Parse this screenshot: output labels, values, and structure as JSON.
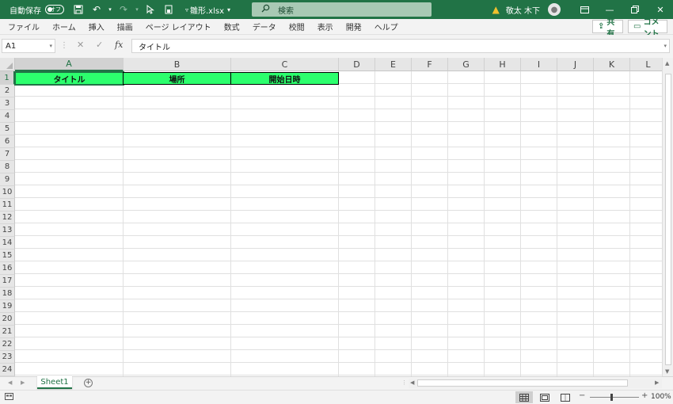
{
  "titlebar": {
    "autosave_label": "自動保存",
    "autosave_state": "オフ",
    "filename": "雛形.xlsx",
    "filename_dropdown": "▾",
    "search_placeholder": "検索",
    "username": "敬太 木下"
  },
  "ribbon": {
    "tabs": [
      "ファイル",
      "ホーム",
      "挿入",
      "描画",
      "ページ レイアウト",
      "数式",
      "データ",
      "校閲",
      "表示",
      "開発",
      "ヘルプ"
    ],
    "share_label": "共有",
    "comment_label": "コメント"
  },
  "formula_bar": {
    "name_box": "A1",
    "fx_label": "fx",
    "content": "タイトル"
  },
  "grid": {
    "columns": [
      "A",
      "B",
      "C",
      "D",
      "E",
      "F",
      "G",
      "H",
      "I",
      "J",
      "K",
      "L"
    ],
    "rows": [
      "1",
      "2",
      "3",
      "4",
      "5",
      "6",
      "7",
      "8",
      "9",
      "10",
      "11",
      "12",
      "13",
      "14",
      "15",
      "16",
      "17",
      "18",
      "19",
      "20",
      "21",
      "22",
      "23",
      "24"
    ],
    "header_cells": [
      "タイトル",
      "場所",
      "開始日時"
    ],
    "header_fill": "#2cff6d",
    "accent": "#217346"
  },
  "sheets": {
    "tabs": [
      "Sheet1"
    ],
    "active": "Sheet1"
  },
  "statusbar": {
    "zoom": "100%"
  }
}
